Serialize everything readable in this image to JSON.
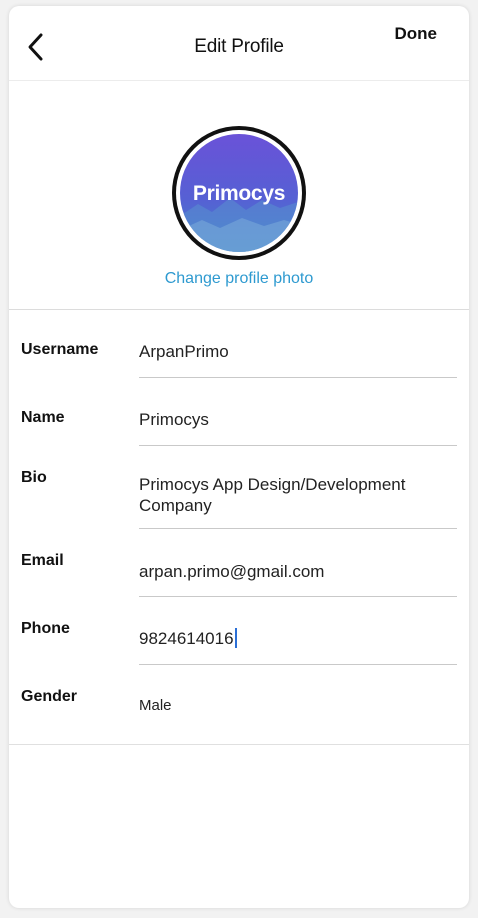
{
  "header": {
    "title": "Edit Profile",
    "done_label": "Done"
  },
  "profile": {
    "logo_text": "Primocys",
    "change_photo_label": "Change profile photo"
  },
  "fields": [
    {
      "label": "Username",
      "value": "ArpanPrimo"
    },
    {
      "label": "Name",
      "value": "Primocys"
    },
    {
      "label": "Bio",
      "value": "Primocys App Design/Development Company"
    },
    {
      "label": "Email",
      "value": "arpan.primo@gmail.com"
    },
    {
      "label": "Phone",
      "value": "9824614016"
    },
    {
      "label": "Gender",
      "value": "Male"
    }
  ],
  "colors": {
    "accent": "#2e9ad0",
    "caret": "#2b6fd6",
    "avatar_gradient": [
      "#5b4fd6",
      "#3a7ed0"
    ]
  },
  "icons": {
    "back": "chevron-left-icon"
  }
}
